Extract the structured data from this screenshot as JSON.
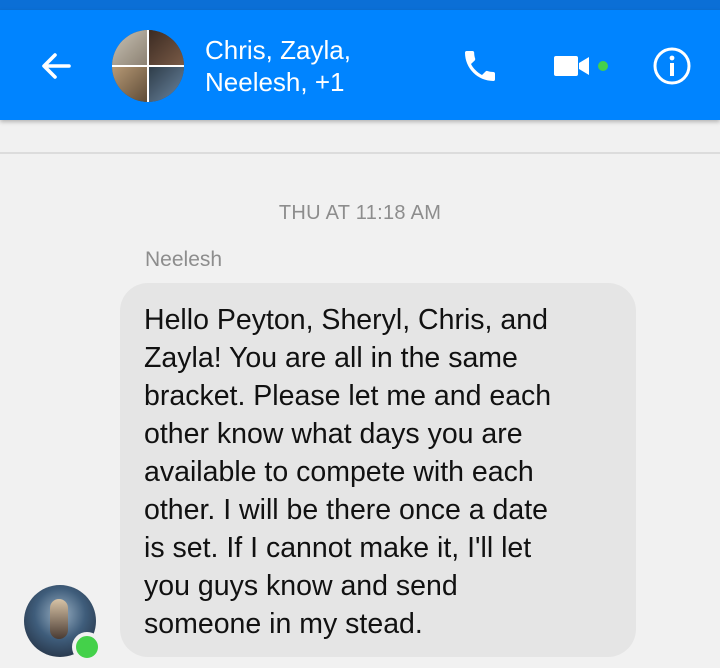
{
  "header": {
    "title_line1": "Chris, Zayla,",
    "title_line2": "Neelesh, +1",
    "back_icon": "back-arrow-icon",
    "call_icon": "phone-icon",
    "video_icon": "video-camera-icon",
    "info_icon": "info-icon",
    "accent_color": "#0084ff"
  },
  "conversation": {
    "timestamp": "THU AT 11:18 AM",
    "messages": [
      {
        "sender": "Neelesh",
        "text": "Hello Peyton, Sheryl, Chris, and\nZayla! You are all in the same\nbracket.  Please let me and each\nother know what days you are\navailable to compete with each\nother.  I will be there once a date\nis set.  If I cannot make it, I'll let\nyou guys know and send\nsomeone in my stead."
      }
    ]
  }
}
